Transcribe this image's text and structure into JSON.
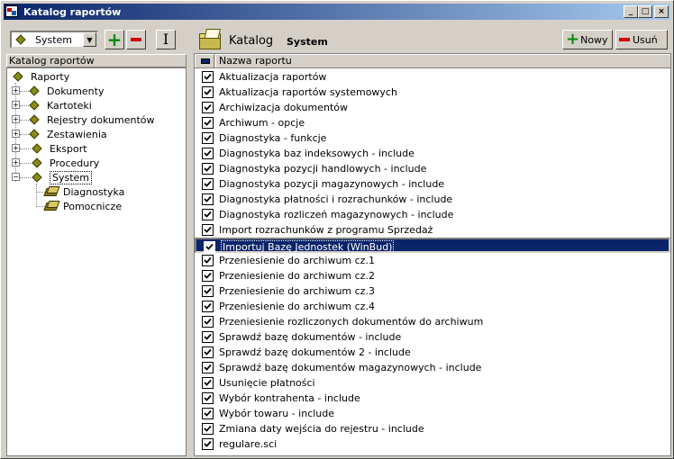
{
  "window": {
    "title": "Katalog raportów",
    "controls": {
      "minimize": "_",
      "maximize": "□",
      "close": "×"
    }
  },
  "left": {
    "selector_value": "System",
    "header": "Katalog raportów",
    "tree": {
      "root": "Raporty",
      "nodes": [
        {
          "label": "Dokumenty",
          "expander": "+"
        },
        {
          "label": "Kartoteki",
          "expander": "+"
        },
        {
          "label": "Rejestry dokumentów",
          "expander": "+"
        },
        {
          "label": "Zestawienia",
          "expander": "+"
        },
        {
          "label": "Eksport",
          "expander": "+"
        },
        {
          "label": "Procedury",
          "expander": "+"
        },
        {
          "label": "System",
          "expander": "−",
          "selected": true
        }
      ],
      "system_children": [
        "Diagnostyka",
        "Pomocnicze"
      ]
    }
  },
  "right": {
    "catalog_label": "Katalog",
    "catalog_value": "System",
    "new_button": "Nowy",
    "delete_button": "Usuń",
    "column_header": "Nazwa raportu",
    "selected_index": 11,
    "rows": [
      "Aktualizacja raportów",
      "Aktualizacja raportów systemowych",
      "Archiwizacja dokumentów",
      "Archiwum - opcje",
      "Diagnostyka - funkcje",
      "Diagnostyka baz indeksowych - include",
      "Diagnostyka pozycji handlowych - include",
      "Diagnostyka pozycji magazynowych - include",
      "Diagnostyka płatności i rozrachunków - include",
      "Diagnostyka rozliczeń magazynowych - include",
      "Import rozrachunków z programu Sprzedaż",
      "Importuj Bazę Jednostek (WinBud)",
      "Przeniesienie do archiwum cz.1",
      "Przeniesienie do archiwum cz.2",
      "Przeniesienie do archiwum cz.3",
      "Przeniesienie do archiwum cz.4",
      "Przeniesienie rozliczonych dokumentów do archiwum",
      "Sprawdź bazę dokumentów - include",
      "Sprawdź bazę dokumentów 2 - include",
      "Sprawdź bazę dokumentów magazynowych - include",
      "Usunięcie płatności",
      "Wybór kontrahenta - include",
      "Wybór towaru - include",
      "Zmiana daty wejścia do rejestru - include",
      "regulare.sci"
    ]
  }
}
